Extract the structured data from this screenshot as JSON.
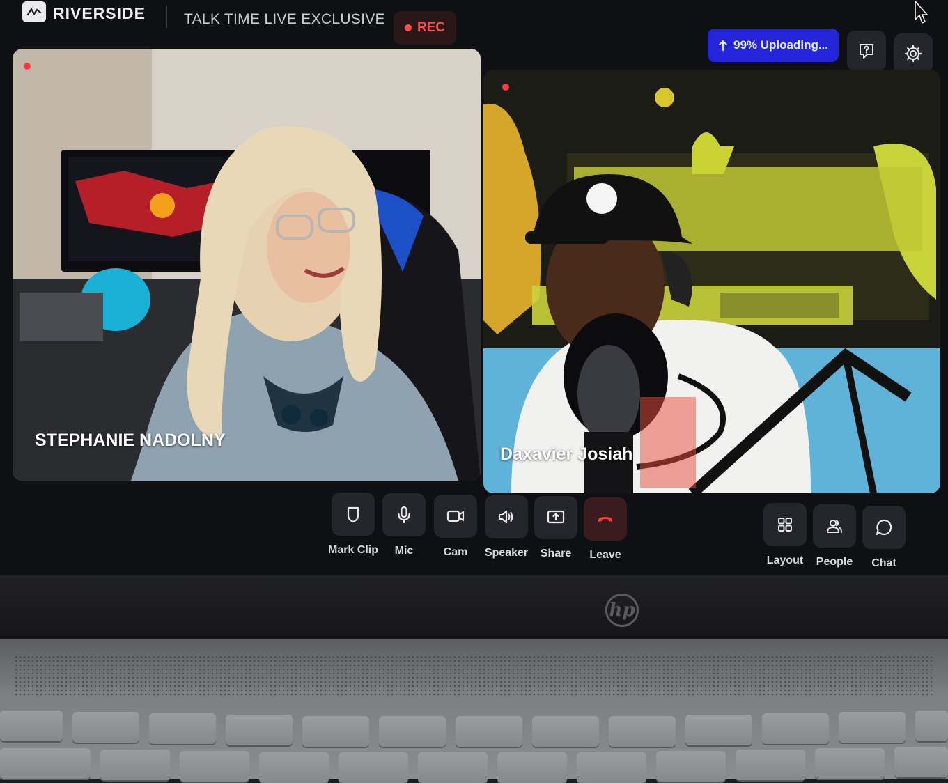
{
  "app": {
    "brand": "RIVERSIDE",
    "session_title": "TALK TIME LIVE EXCLUSIVE",
    "rec_label": "REC"
  },
  "header": {
    "upload_status": "99% Uploading...",
    "help_icon": "help-chat-icon",
    "settings_icon": "gear-icon"
  },
  "participants": [
    {
      "name": "STEPHANIE NADOLNY",
      "recording": true
    },
    {
      "name": "Daxavier Josiah",
      "recording": true
    }
  ],
  "controls": {
    "mark_clip": "Mark Clip",
    "mic": "Mic",
    "cam": "Cam",
    "speaker": "Speaker",
    "share": "Share",
    "leave": "Leave",
    "layout": "Layout",
    "people": "People",
    "chat": "Chat"
  },
  "colors": {
    "rec_red": "#ff4d4d",
    "upload_blue": "#2424d8",
    "leave_red": "#ff3b3b",
    "background": "#0f1013"
  }
}
